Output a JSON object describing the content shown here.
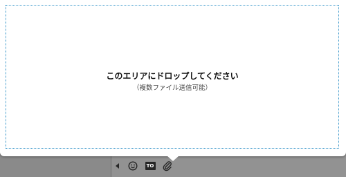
{
  "dropzone": {
    "main_text": "このエリアにドロップしてください",
    "sub_text": "（複数ファイル送信可能）"
  },
  "toolbar": {
    "collapse_icon": "caret-left-icon",
    "emoji_icon": "smiley-icon",
    "to_label": "TO",
    "attach_icon": "paperclip-icon"
  },
  "colors": {
    "dropzone_border": "#2b8fc6",
    "backdrop": "#8e8e8e",
    "icon": "#262626"
  }
}
